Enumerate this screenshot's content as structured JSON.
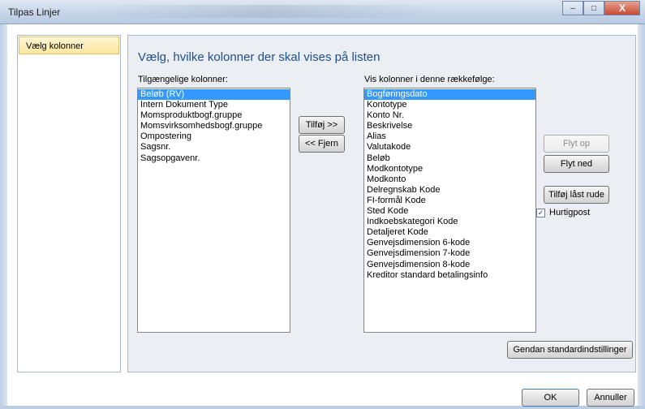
{
  "window": {
    "title": "Tilpas Linjer",
    "minimize": "–",
    "maximize": "□",
    "close": "X"
  },
  "nav": {
    "items": [
      {
        "label": "Vælg kolonner",
        "selected": true
      }
    ]
  },
  "main": {
    "heading": "Vælg, hvilke kolonner der skal vises på listen",
    "available_label": "Tilgængelige kolonner:",
    "available": [
      "Beløb (RV)",
      "Intern Dokument Type",
      "Momsproduktbogf.gruppe",
      "Momsvirksomhedsbogf.gruppe",
      "Ompostering",
      "Sagsnr.",
      "Sagsopgavenr."
    ],
    "available_selected": "Beløb (RV)",
    "add_button": "Tilføj >>",
    "remove_button": "<< Fjern",
    "shown_label": "Vis kolonner i denne rækkefølge:",
    "shown": [
      "Bogføringsdato",
      "Kontotype",
      "Konto Nr.",
      "Beskrivelse",
      "Alias",
      "Valutakode",
      "Beløb",
      "Modkontotype",
      "Modkonto",
      "Delregnskab Kode",
      "FI-formål Kode",
      "Sted Kode",
      "Indkoebskategori Kode",
      "Detaljeret Kode",
      "Genvejsdimension 6-kode",
      "Genvejsdimension 7-kode",
      "Genvejsdimension 8-kode",
      "Kreditor standard betalingsinfo"
    ],
    "shown_selected": "Bogføringsdato",
    "move_up": "Flyt op",
    "move_up_enabled": false,
    "move_down": "Flyt ned",
    "add_locked": "Tilføj låst rude",
    "quickpost_label": "Hurtigpost",
    "quickpost_checked": true,
    "check_glyph": "✓",
    "restore_defaults": "Gendan standardindstillinger"
  },
  "footer": {
    "ok": "OK",
    "cancel": "Annuller"
  },
  "colors": {
    "heading": "#1f4f8f",
    "selection": "#3399ff",
    "nav_selected": "#fde7a0",
    "panel_bg": "#ebeef2"
  }
}
